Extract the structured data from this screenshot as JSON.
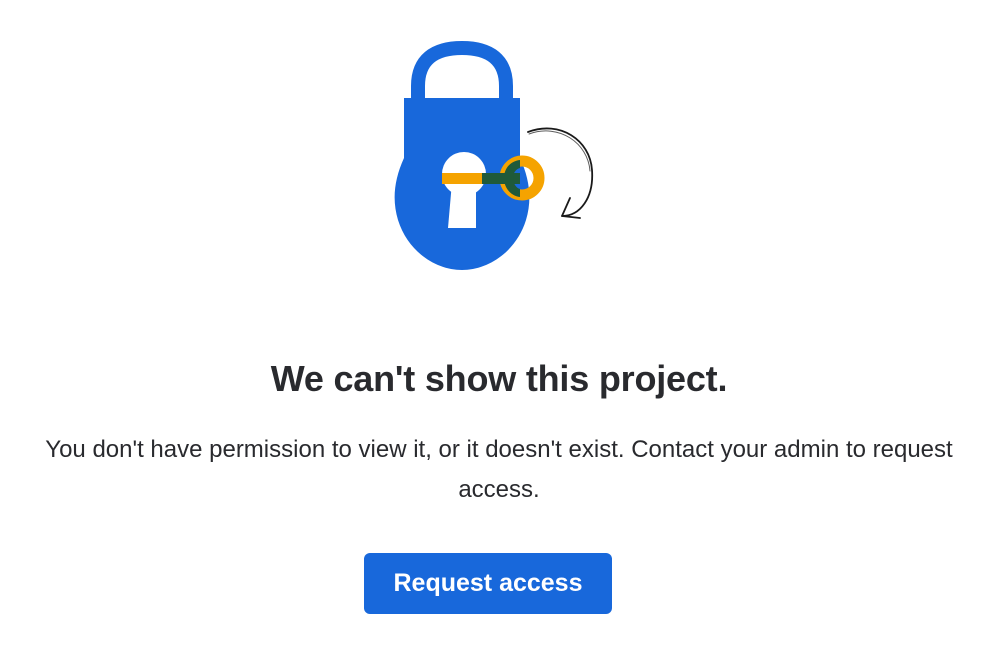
{
  "illustration": {
    "icon": "padlock-with-key-icon",
    "colors": {
      "lock": "#1868db",
      "key": "#f5a300",
      "key_overlap": "#1f5a3a",
      "keyhole": "#ffffff",
      "arrow": "#1a1a1a"
    }
  },
  "title": "We can't show this project.",
  "message": "You don't have permission to view it, or it doesn't exist. Contact your admin to request access.",
  "primary_action": {
    "label": "Request access",
    "color": "#1868db"
  }
}
